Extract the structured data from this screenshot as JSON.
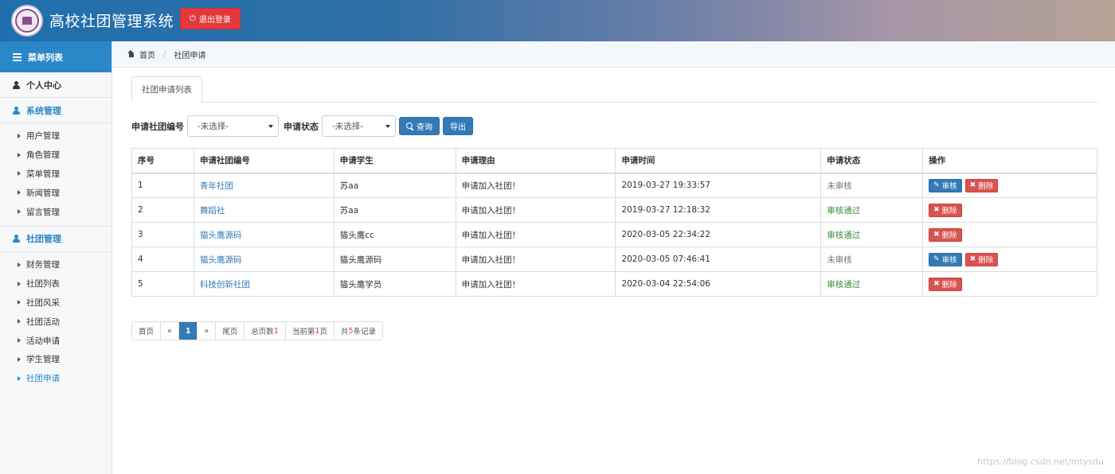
{
  "header": {
    "title": "高校社团管理系统",
    "logout_label": "退出登录",
    "logout_icon": "power-icon"
  },
  "sidebar": {
    "menu_title": "菜单列表",
    "personal_center": "个人中心",
    "groups": [
      {
        "label": "系统管理",
        "items": [
          "用户管理",
          "角色管理",
          "菜单管理",
          "新闻管理",
          "留言管理"
        ]
      },
      {
        "label": "社团管理",
        "items": [
          "财务管理",
          "社团列表",
          "社团风采",
          "社团活动",
          "活动申请",
          "学生管理",
          "社团申请"
        ]
      }
    ],
    "active_item": "社团申请"
  },
  "breadcrumb": {
    "home": "首页",
    "current": "社团申请"
  },
  "tabs": {
    "active": "社团申请列表"
  },
  "search": {
    "club_label": "申请社团编号",
    "club_value": "-未选择-",
    "status_label": "申请状态",
    "status_value": "-未选择-",
    "query_label": "查询",
    "export_label": "导出"
  },
  "table": {
    "headers": [
      "序号",
      "申请社团编号",
      "申请学生",
      "申请理由",
      "申请时间",
      "申请状态",
      "操作"
    ],
    "review_label": "审核",
    "delete_label": "删除",
    "rows": [
      {
        "no": "1",
        "club": "青年社团",
        "student": "苏aa",
        "reason": "申请加入社团！",
        "time": "2019-03-27 19:33:57",
        "status": "未审核",
        "status_type": "pending"
      },
      {
        "no": "2",
        "club": "舞蹈社",
        "student": "苏aa",
        "reason": "申请加入社团！",
        "time": "2019-03-27 12:18:32",
        "status": "审核通过",
        "status_type": "ok"
      },
      {
        "no": "3",
        "club": "猫头鹰源码",
        "student": "猫头鹰cc",
        "reason": "申请加入社团！",
        "time": "2020-03-05 22:34:22",
        "status": "审核通过",
        "status_type": "ok"
      },
      {
        "no": "4",
        "club": "猫头鹰源码",
        "student": "猫头鹰源码",
        "reason": "申请加入社团！",
        "time": "2020-03-05 07:46:41",
        "status": "未审核",
        "status_type": "pending"
      },
      {
        "no": "5",
        "club": "科技创新社团",
        "student": "猫头鹰学员",
        "reason": "申请加入社团！",
        "time": "2020-03-04 22:54:06",
        "status": "审核通过",
        "status_type": "ok"
      }
    ]
  },
  "pagination": {
    "first": "首页",
    "prev": "«",
    "current_page": "1",
    "next": "»",
    "last": "尾页",
    "total_pages_prefix": "总页数",
    "total_pages": "1",
    "current_prefix": "当前第",
    "current_num": "1",
    "current_suffix": "页",
    "records_prefix": "共",
    "records_num": "5",
    "records_suffix": "条记录"
  },
  "watermark": "https://blog.csdn.net/mtysdu",
  "colors": {
    "primary": "#337ab7",
    "danger": "#d9534f",
    "sidebar_accent": "#2a88c8",
    "success_text": "#3c8d3c"
  }
}
